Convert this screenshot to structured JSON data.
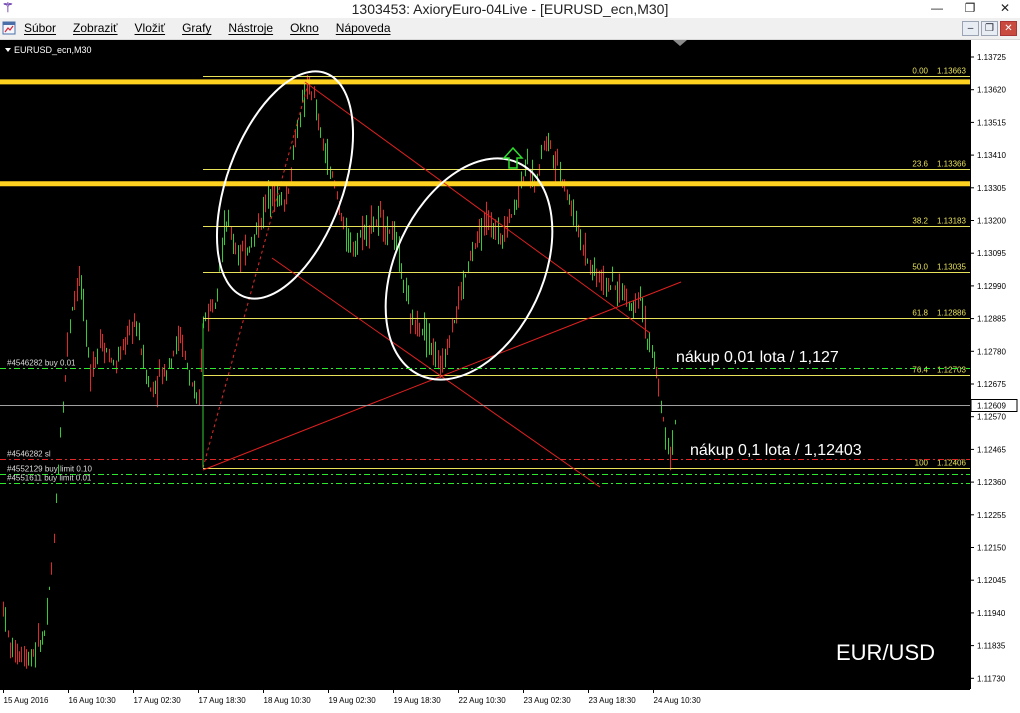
{
  "window": {
    "title": "1303453: AxioryEuro-04Live - [EURUSD_ecn,M30]",
    "controls": {
      "minimize": "—",
      "restore": "❐",
      "close": "✕"
    }
  },
  "menu": {
    "items": [
      {
        "label": "Súbor"
      },
      {
        "label": "Zobraziť"
      },
      {
        "label": "Vložiť"
      },
      {
        "label": "Grafy"
      },
      {
        "label": "Nástroje"
      },
      {
        "label": "Okno"
      },
      {
        "label": "Nápoveda"
      }
    ],
    "mdi": {
      "minimize": "–",
      "restore": "❐",
      "close": "✕"
    }
  },
  "chart": {
    "symbol_label": "EURUSD_ecn,M30",
    "watermark": "EUR/USD",
    "colors": {
      "background": "#000000",
      "bull": "#33cc33",
      "bear": "#e32727",
      "fib": "#e8e15a",
      "resistance": "#ffd21f",
      "channel": "#e02020",
      "pending": "#2eea2e",
      "text": "#ffffff",
      "axis_text": "#000000"
    },
    "price_axis": {
      "labels": [
        "1.13725",
        "1.13620",
        "1.13515",
        "1.13410",
        "1.13305",
        "1.13200",
        "1.13095",
        "1.12990",
        "1.12885",
        "1.12780",
        "1.12675",
        "1.12570",
        "1.12465",
        "1.12360",
        "1.12255",
        "1.12150",
        "1.12045",
        "1.11940",
        "1.11835",
        "1.11730"
      ],
      "current_price": "1.12609"
    },
    "time_axis": {
      "labels": [
        "15 Aug 2016",
        "16 Aug 10:30",
        "17 Aug 02:30",
        "17 Aug 18:30",
        "18 Aug 10:30",
        "19 Aug 02:30",
        "19 Aug 18:30",
        "22 Aug 10:30",
        "23 Aug 02:30",
        "23 Aug 18:30",
        "24 Aug 10:30"
      ]
    },
    "fibonacci": [
      {
        "level": "0.00",
        "price": "1.13663",
        "value": 1.13663
      },
      {
        "level": "23.6",
        "price": "1.13366",
        "value": 1.13366
      },
      {
        "level": "38.2",
        "price": "1.13183",
        "value": 1.13183
      },
      {
        "level": "50.0",
        "price": "1.13035",
        "value": 1.13035
      },
      {
        "level": "61.8",
        "price": "1.12886",
        "value": 1.12886
      },
      {
        "level": "76.4",
        "price": "1.12703",
        "value": 1.12703
      },
      {
        "level": "100",
        "price": "1.12406",
        "value": 1.12406
      }
    ],
    "resistance_levels": [
      1.13645,
      1.13318
    ],
    "orders": [
      {
        "label": "#4546282 buy 0.01",
        "value": 1.12727,
        "kind": "pending"
      },
      {
        "label": "#4546282 sl",
        "value": 1.12435,
        "kind": "sl"
      },
      {
        "label": "#4552129 buy limit 0.10",
        "value": 1.12385,
        "kind": "pending"
      },
      {
        "label": "#4551611 buy limit 0.01",
        "value": 1.12358,
        "kind": "pending"
      }
    ],
    "annotations": [
      {
        "text": "nákup 0,01 lota / 1,127"
      },
      {
        "text": "nákup 0,1 lota / 1,12403"
      }
    ]
  }
}
